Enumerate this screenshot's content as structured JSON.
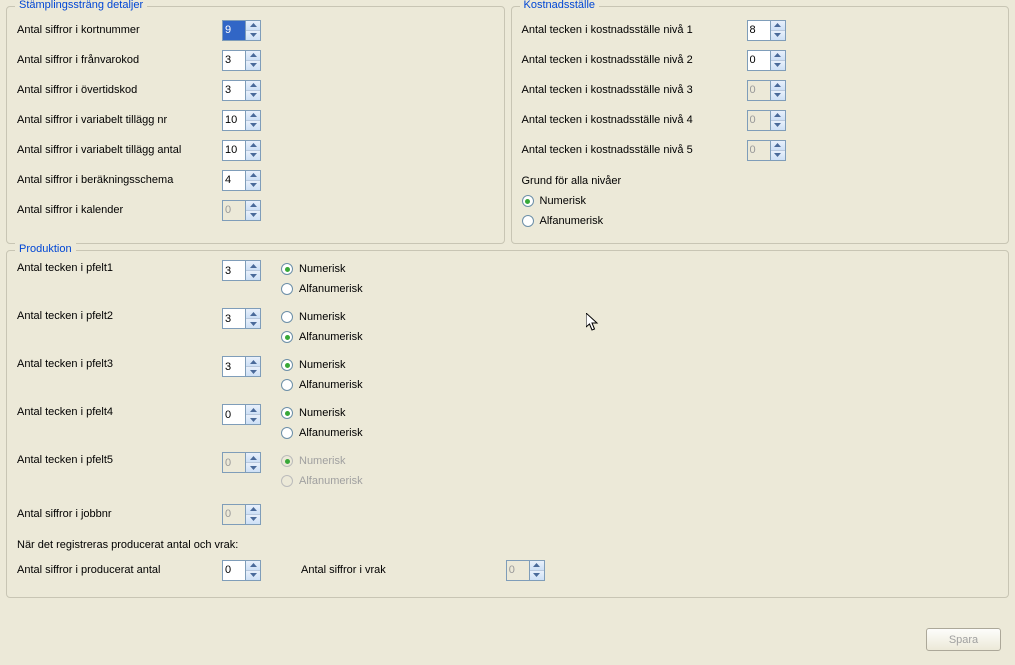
{
  "groups": {
    "stampling": {
      "title": "Stämplingssträng detaljer",
      "rows": [
        {
          "label": "Antal siffror i kortnummer",
          "value": "9",
          "disabled": false,
          "selected": true
        },
        {
          "label": "Antal siffror i frånvarokod",
          "value": "3",
          "disabled": false
        },
        {
          "label": "Antal siffror i övertidskod",
          "value": "3",
          "disabled": false
        },
        {
          "label": "Antal siffror i variabelt tillägg nr",
          "value": "10",
          "disabled": false
        },
        {
          "label": "Antal siffror i variabelt tillägg antal",
          "value": "10",
          "disabled": false
        },
        {
          "label": "Antal siffror i beräkningsschema",
          "value": "4",
          "disabled": false
        },
        {
          "label": "Antal siffror i kalender",
          "value": "0",
          "disabled": true
        }
      ]
    },
    "kostnad": {
      "title": "Kostnadsställe",
      "rows": [
        {
          "label": "Antal tecken i kostnadsställe nivå 1",
          "value": "8",
          "disabled": false
        },
        {
          "label": "Antal tecken i kostnadsställe nivå 2",
          "value": "0",
          "disabled": false
        },
        {
          "label": "Antal tecken i kostnadsställe nivå 3",
          "value": "0",
          "disabled": true
        },
        {
          "label": "Antal tecken i kostnadsställe nivå 4",
          "value": "0",
          "disabled": true
        },
        {
          "label": "Antal tecken i kostnadsställe nivå 5",
          "value": "0",
          "disabled": true
        }
      ],
      "basis": {
        "heading": "Grund för alla nivåer",
        "options": {
          "numeric": "Numerisk",
          "alpha": "Alfanumerisk"
        },
        "selected": "numeric"
      }
    },
    "produktion": {
      "title": "Produktion",
      "pfelt": [
        {
          "label": "Antal tecken i pfelt1",
          "value": "3",
          "disabled": false,
          "type": "numeric",
          "typeDisabled": false
        },
        {
          "label": "Antal tecken i pfelt2",
          "value": "3",
          "disabled": false,
          "type": "alpha",
          "typeDisabled": false
        },
        {
          "label": "Antal tecken i pfelt3",
          "value": "3",
          "disabled": false,
          "type": "numeric",
          "typeDisabled": false
        },
        {
          "label": "Antal tecken i pfelt4",
          "value": "0",
          "disabled": false,
          "type": "numeric",
          "typeDisabled": false
        },
        {
          "label": "Antal tecken i pfelt5",
          "value": "0",
          "disabled": true,
          "type": "numeric",
          "typeDisabled": true
        }
      ],
      "options": {
        "numeric": "Numerisk",
        "alpha": "Alfanumerisk"
      },
      "jobbnr": {
        "label": "Antal siffror i jobbnr",
        "value": "0",
        "disabled": true
      },
      "note": "När det registreras producerat antal och vrak:",
      "produced": {
        "label": "Antal siffror i producerat antal",
        "value": "0",
        "disabled": false
      },
      "vrak": {
        "label": "Antal siffror i vrak",
        "value": "0",
        "disabled": true
      }
    }
  },
  "buttons": {
    "save": "Spara"
  }
}
